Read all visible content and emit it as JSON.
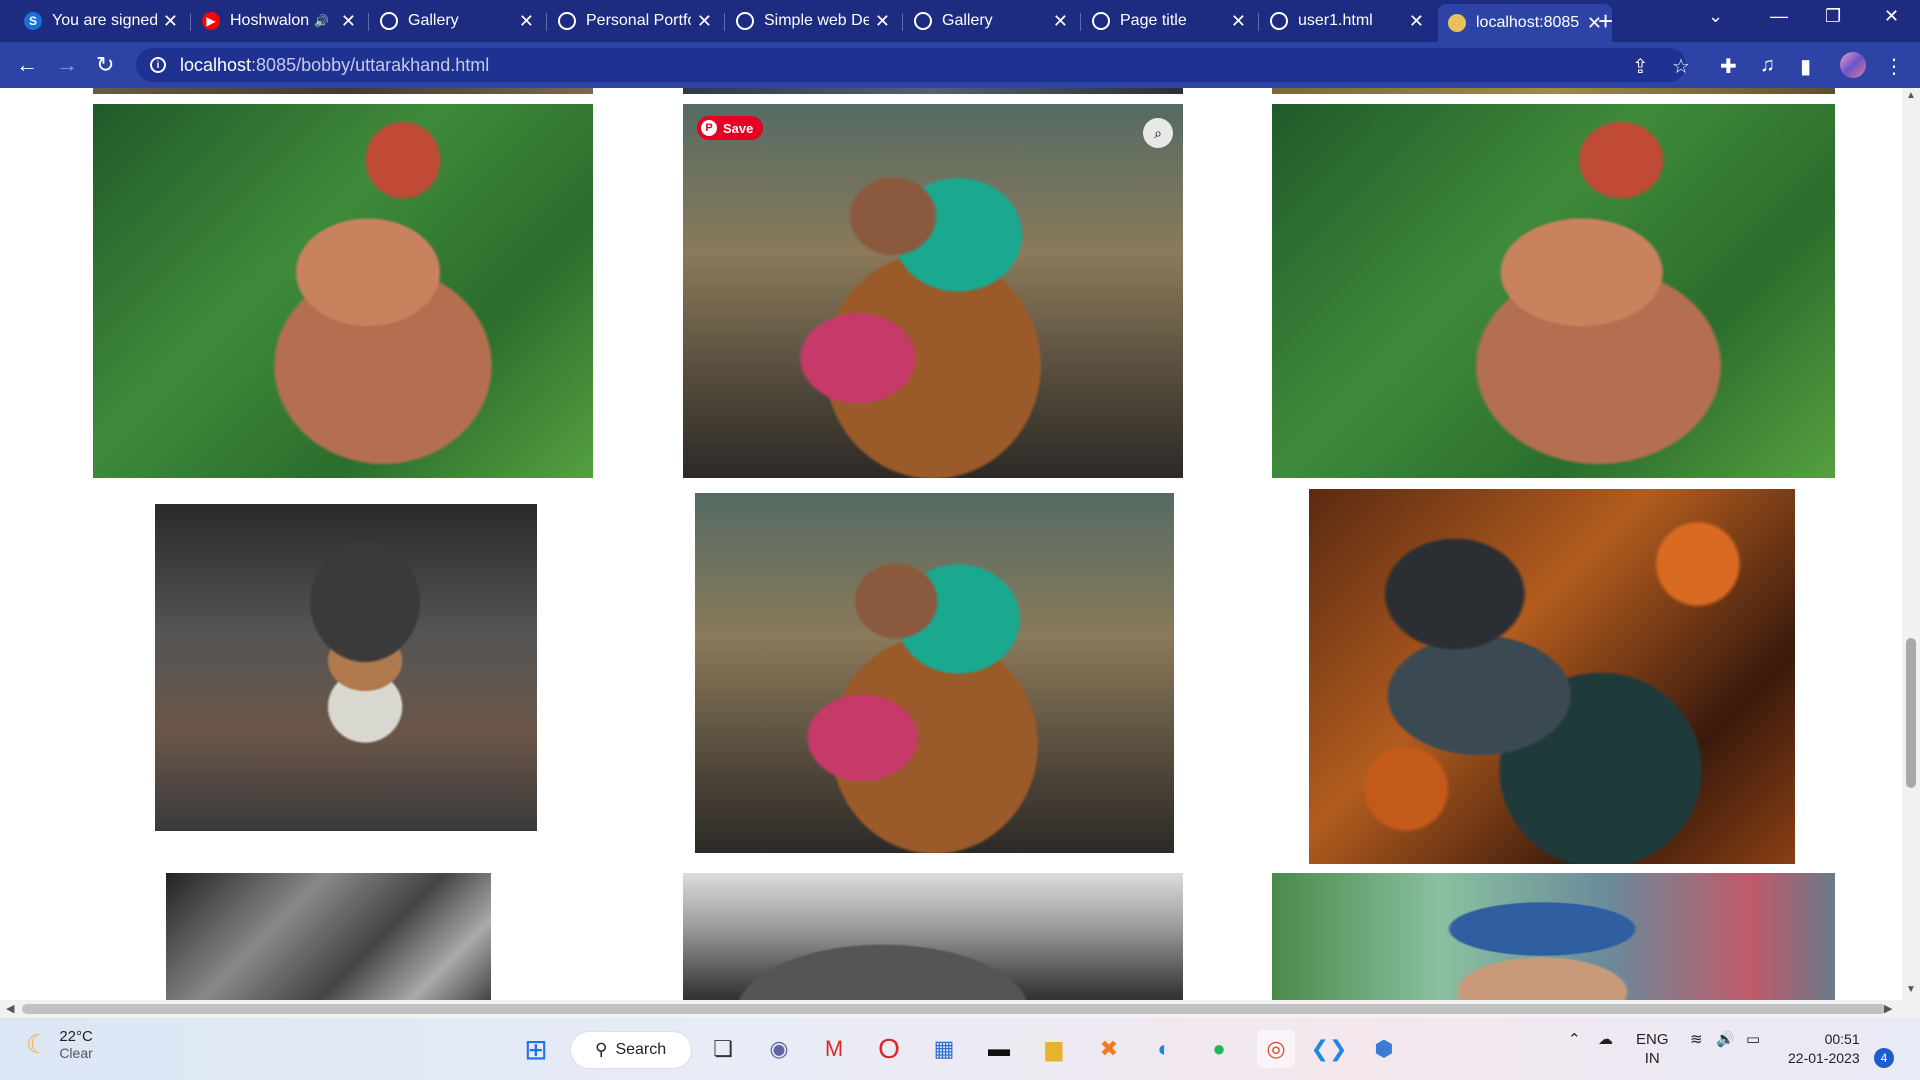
{
  "browser": {
    "tabs": [
      {
        "title": "You are signed",
        "favicon": "simplilearn-icon",
        "fav_color": "#1b6fd8",
        "fav_text": "S"
      },
      {
        "title": "Hoshwalon",
        "favicon": "youtube-icon",
        "fav_color": "#ff0000",
        "fav_text": "▶",
        "audio": "🔊"
      },
      {
        "title": "Gallery",
        "favicon": "globe-icon",
        "fav_color": "#ffffff",
        "fav_text": ""
      },
      {
        "title": "Personal Portfo",
        "favicon": "globe-icon",
        "fav_color": "#ffffff",
        "fav_text": ""
      },
      {
        "title": "Simple web De",
        "favicon": "globe-icon",
        "fav_color": "#ffffff",
        "fav_text": ""
      },
      {
        "title": "Gallery",
        "favicon": "globe-icon",
        "fav_color": "#ffffff",
        "fav_text": ""
      },
      {
        "title": "Page title",
        "favicon": "globe-icon",
        "fav_color": "#ffffff",
        "fav_text": ""
      },
      {
        "title": "user1.html",
        "favicon": "globe-icon",
        "fav_color": "#ffffff",
        "fav_text": ""
      },
      {
        "title": "localhost:8085",
        "favicon": "photo-icon",
        "fav_color": "#e9c15a",
        "fav_text": "",
        "active": true
      }
    ],
    "close_glyph": "✕",
    "new_tab_glyph": "+",
    "url_host": "localhost",
    "url_rest": ":8085/bobby/uttarakhand.html"
  },
  "page": {
    "pin_save_label": "Save",
    "pin_glyph": "P",
    "lens_glyph": "⌕"
  },
  "taskbar": {
    "temperature": "22°C",
    "condition": "Clear",
    "search_label": "Search",
    "language": "ENG",
    "region": "IN",
    "time": "00:51",
    "date": "22-01-2023",
    "notification_count": "4"
  }
}
